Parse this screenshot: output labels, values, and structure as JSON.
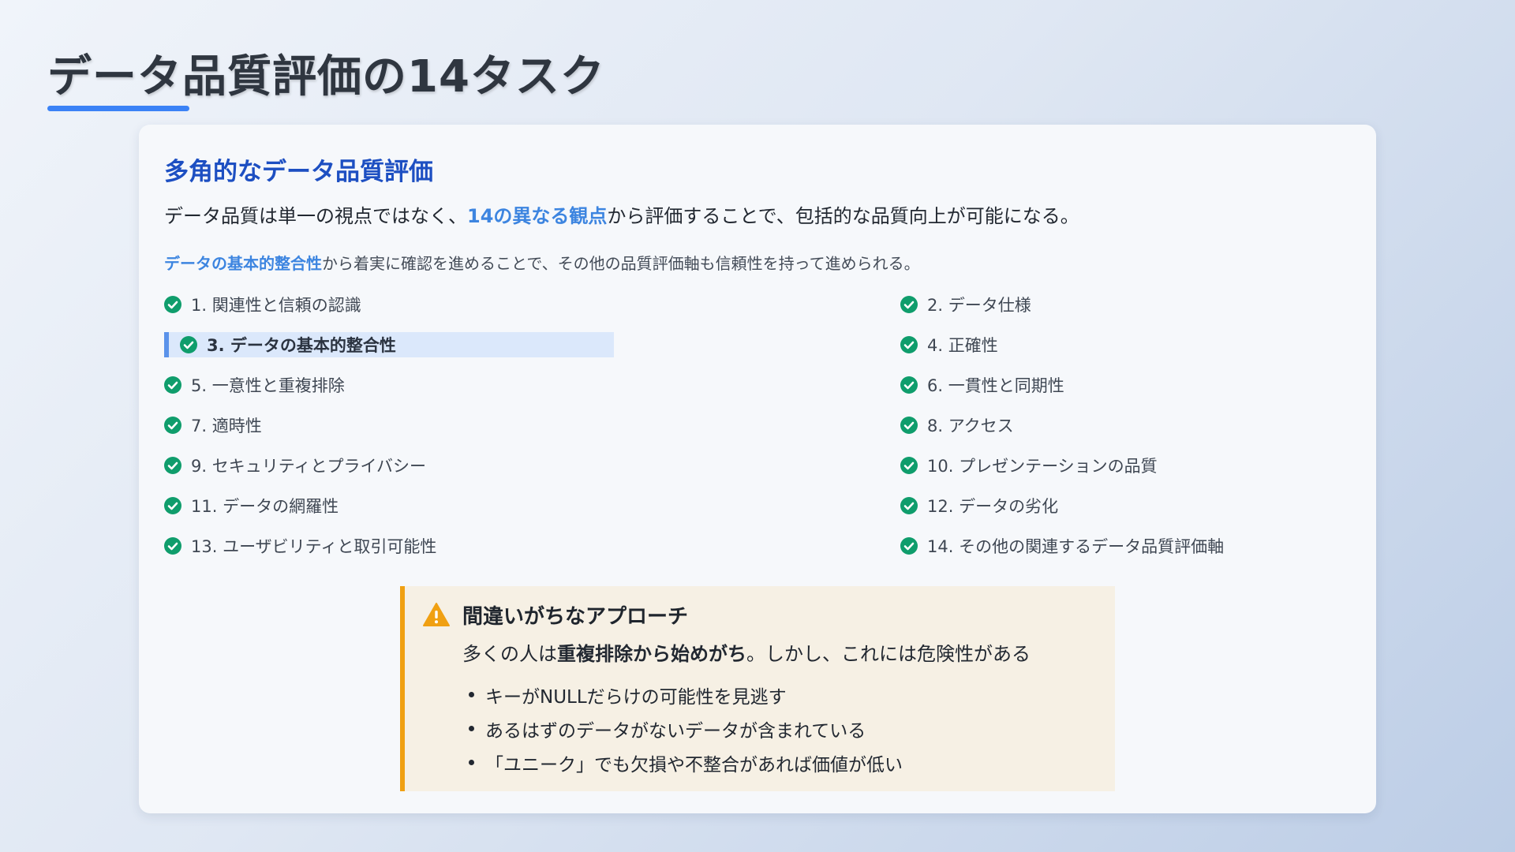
{
  "slide": {
    "title": "データ品質評価の14タスク"
  },
  "card": {
    "heading": "多角的なデータ品質評価",
    "intro": {
      "before": "データ品質は単一の視点ではなく、",
      "highlight": "14の異なる観点",
      "after": "から評価することで、包括的な品質向上が可能になる。"
    },
    "note": {
      "highlight": "データの基本的整合性",
      "after": "から着実に確認を進めることで、その他の品質評価軸も信頼性を持って進められる。"
    },
    "tasks_left": [
      {
        "label": "1. 関連性と信頼の認識"
      },
      {
        "label": "3. データの基本的整合性"
      },
      {
        "label": "5. 一意性と重複排除"
      },
      {
        "label": "7. 適時性"
      },
      {
        "label": "9. セキュリティとプライバシー"
      },
      {
        "label": "11. データの網羅性"
      },
      {
        "label": "13. ユーザビリティと取引可能性"
      }
    ],
    "tasks_right": [
      {
        "label": "2. データ仕様"
      },
      {
        "label": "4. 正確性"
      },
      {
        "label": "6. 一貫性と同期性"
      },
      {
        "label": "8. アクセス"
      },
      {
        "label": "10. プレゼンテーションの品質"
      },
      {
        "label": "12. データの劣化"
      },
      {
        "label": "14. その他の関連するデータ品質評価軸"
      }
    ],
    "highlighted_task": "3. データの基本的整合性"
  },
  "warning": {
    "icon": "warning-triangle-icon",
    "title": "間違いがちなアプローチ",
    "text_before": "多くの人は",
    "text_bold": "重複排除から始めがち",
    "text_after": "。しかし、これには危険性がある",
    "bullets": [
      "キーがNULLだらけの可能性を見逃す",
      "あるはずのデータがないデータが含まれている",
      "「ユニーク」でも欠損や不整合があれば価値が低い"
    ]
  },
  "colors": {
    "accent_blue": "#3b82f6",
    "heading_blue": "#1d4fc2",
    "check_green": "#0f9d6c",
    "warning_orange": "#f0a012",
    "warning_bg": "#f6f0e4",
    "highlight_bg": "#dbe8fb"
  }
}
